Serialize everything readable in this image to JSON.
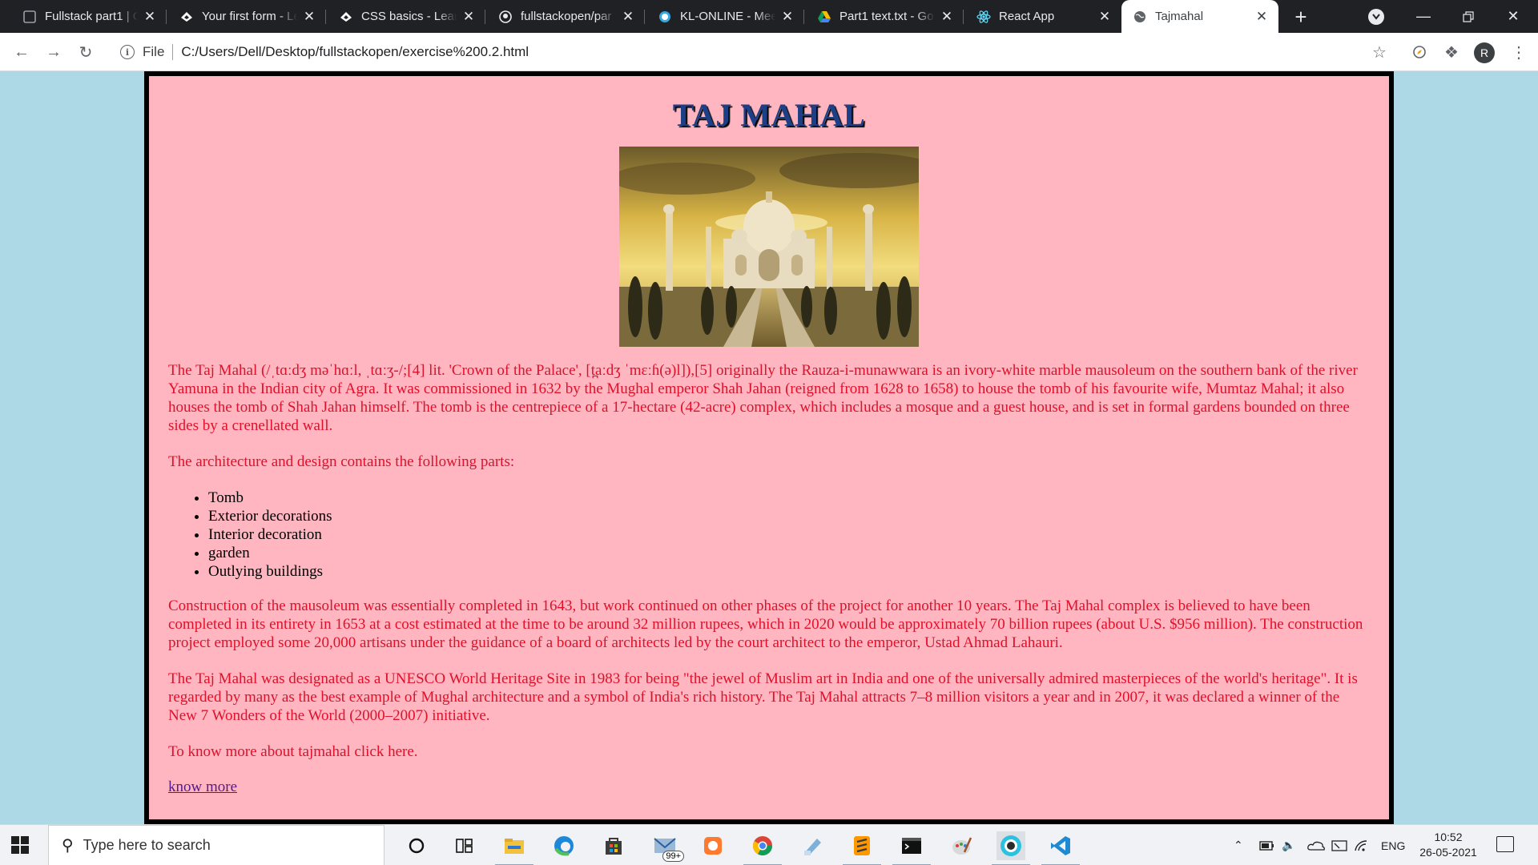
{
  "browser": {
    "tabs": [
      {
        "title": "Fullstack part1 | C",
        "icon": "generic-app-icon"
      },
      {
        "title": "Your first form - Le",
        "icon": "mdn-icon"
      },
      {
        "title": "CSS basics - Learn",
        "icon": "mdn-icon"
      },
      {
        "title": "fullstackopen/par",
        "icon": "github-icon"
      },
      {
        "title": "KL-ONLINE - Mee",
        "icon": "moodle-icon"
      },
      {
        "title": "Part1 text.txt - Go",
        "icon": "google-drive-icon"
      },
      {
        "title": "React App",
        "icon": "react-icon"
      },
      {
        "title": "Tajmahal",
        "icon": "globe-icon"
      }
    ],
    "active_tab_index": 7,
    "address": {
      "scheme_label": "File",
      "url": "C:/Users/Dell/Desktop/fullstackopen/exercise%200.2.html"
    },
    "profile_initial": "R"
  },
  "page": {
    "heading": "TAJ MAHAL",
    "intro": "The Taj Mahal (/ˌtɑːdʒ məˈhɑːl, ˌtɑːʒ-/;[4] lit. 'Crown of the Palace', [t̪aːdʒ ˈmɛːɦ(ə)l]),[5] originally the Rauza-i-munawwara is an ivory-white marble mausoleum on the southern bank of the river Yamuna in the Indian city of Agra. It was commissioned in 1632 by the Mughal emperor Shah Jahan (reigned from 1628 to 1658) to house the tomb of his favourite wife, Mumtaz Mahal; it also houses the tomb of Shah Jahan himself. The tomb is the centrepiece of a 17-hectare (42-acre) complex, which includes a mosque and a guest house, and is set in formal gardens bounded on three sides by a crenellated wall.",
    "parts_intro": "The architecture and design contains the following parts:",
    "parts": [
      "Tomb",
      "Exterior decorations",
      "Interior decoration",
      "garden",
      "Outlying buildings"
    ],
    "construction": "Construction of the mausoleum was essentially completed in 1643, but work continued on other phases of the project for another 10 years. The Taj Mahal complex is believed to have been completed in its entirety in 1653 at a cost estimated at the time to be around 32 million rupees, which in 2020 would be approximately 70 billion rupees (about U.S. $956 million). The construction project employed some 20,000 artisans under the guidance of a board of architects led by the court architect to the emperor, Ustad Ahmad Lahauri.",
    "unesco": "The Taj Mahal was designated as a UNESCO World Heritage Site in 1983 for being \"the jewel of Muslim art in India and one of the universally admired masterpieces of the world's heritage\". It is regarded by many as the best example of Mughal architecture and a symbol of India's rich history. The Taj Mahal attracts 7–8 million visitors a year and in 2007, it was declared a winner of the New 7 Wonders of the World (2000–2007) initiative.",
    "know_more_prompt": "To know more about tajmahal click here.",
    "know_more_link": "know more",
    "colors": {
      "background": "#add8e6",
      "box": "#ffb6c1",
      "text": "#e0102a",
      "heading": "#1c3f86"
    }
  },
  "taskbar": {
    "search_placeholder": "Type here to search",
    "mail_badge": "99+",
    "language": "ENG",
    "time": "10:52",
    "date": "26-05-2021",
    "apps": [
      "cortana-icon",
      "task-view-icon",
      "file-explorer-icon",
      "edge-icon",
      "store-icon",
      "mail-icon",
      "photos-icon",
      "chrome-icon",
      "notepad-icon",
      "sublime-icon",
      "terminal-icon",
      "paint-icon",
      "moodle-app-icon",
      "vscode-icon"
    ]
  }
}
